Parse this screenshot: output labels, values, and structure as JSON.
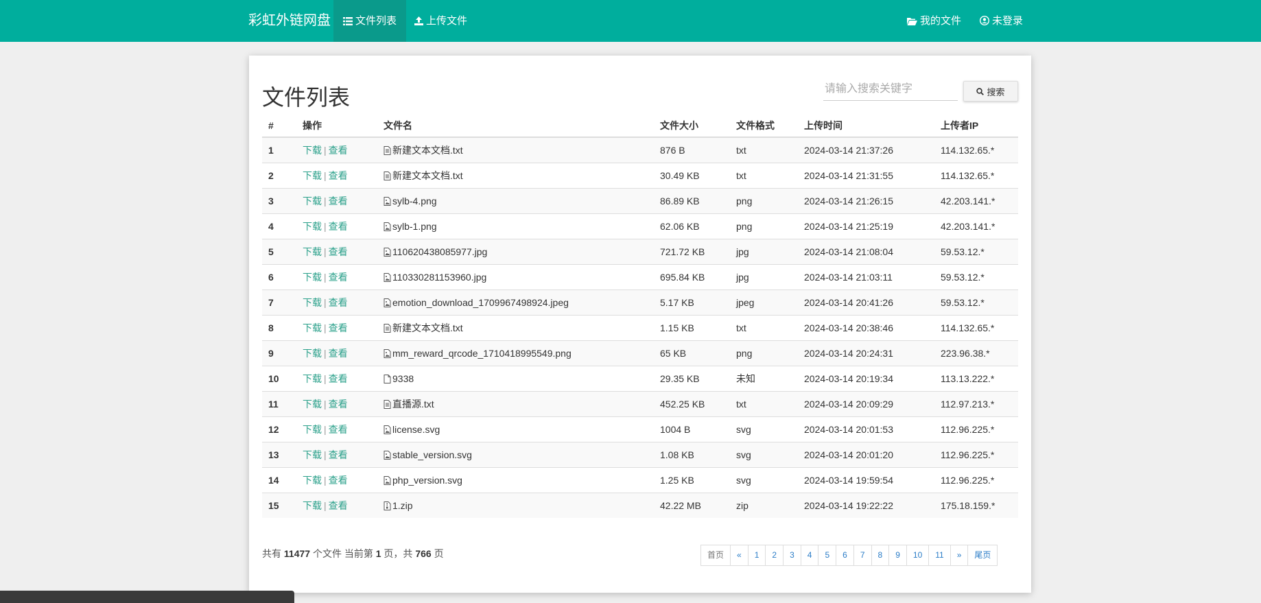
{
  "nav": {
    "brand": "彩虹外链网盘",
    "items": [
      {
        "label": "文件列表",
        "icon": "list-icon"
      },
      {
        "label": "上传文件",
        "icon": "upload-icon"
      }
    ],
    "right_items": [
      {
        "label": "我的文件",
        "icon": "folder-open-icon"
      },
      {
        "label": "未登录",
        "icon": "user-circle-icon"
      }
    ]
  },
  "panel": {
    "title": "文件列表",
    "search": {
      "placeholder": "请输入搜索关键字",
      "button": "搜索"
    }
  },
  "table": {
    "headers": [
      "#",
      "操作",
      "文件名",
      "文件大小",
      "文件格式",
      "上传时间",
      "上传者IP"
    ],
    "action_download": "下载",
    "action_view": "查看",
    "rows": [
      {
        "n": "1",
        "name": "新建文本文档.txt",
        "icon": "text-file-icon",
        "size": "876 B",
        "fmt": "txt",
        "time": "2024-03-14 21:37:26",
        "ip": "114.132.65.*"
      },
      {
        "n": "2",
        "name": "新建文本文档.txt",
        "icon": "text-file-icon",
        "size": "30.49 KB",
        "fmt": "txt",
        "time": "2024-03-14 21:31:55",
        "ip": "114.132.65.*"
      },
      {
        "n": "3",
        "name": "sylb-4.png",
        "icon": "image-file-icon",
        "size": "86.89 KB",
        "fmt": "png",
        "time": "2024-03-14 21:26:15",
        "ip": "42.203.141.*"
      },
      {
        "n": "4",
        "name": "sylb-1.png",
        "icon": "image-file-icon",
        "size": "62.06 KB",
        "fmt": "png",
        "time": "2024-03-14 21:25:19",
        "ip": "42.203.141.*"
      },
      {
        "n": "5",
        "name": "110620438085977.jpg",
        "icon": "image-file-icon",
        "size": "721.72 KB",
        "fmt": "jpg",
        "time": "2024-03-14 21:08:04",
        "ip": "59.53.12.*"
      },
      {
        "n": "6",
        "name": "110330281153960.jpg",
        "icon": "image-file-icon",
        "size": "695.84 KB",
        "fmt": "jpg",
        "time": "2024-03-14 21:03:11",
        "ip": "59.53.12.*"
      },
      {
        "n": "7",
        "name": "emotion_download_1709967498924.jpeg",
        "icon": "image-file-icon",
        "size": "5.17 KB",
        "fmt": "jpeg",
        "time": "2024-03-14 20:41:26",
        "ip": "59.53.12.*"
      },
      {
        "n": "8",
        "name": "新建文本文档.txt",
        "icon": "text-file-icon",
        "size": "1.15 KB",
        "fmt": "txt",
        "time": "2024-03-14 20:38:46",
        "ip": "114.132.65.*"
      },
      {
        "n": "9",
        "name": "mm_reward_qrcode_1710418995549.png",
        "icon": "image-file-icon",
        "size": "65 KB",
        "fmt": "png",
        "time": "2024-03-14 20:24:31",
        "ip": "223.96.38.*"
      },
      {
        "n": "10",
        "name": "9338",
        "icon": "blank-file-icon",
        "size": "29.35 KB",
        "fmt": "未知",
        "time": "2024-03-14 20:19:34",
        "ip": "113.13.222.*"
      },
      {
        "n": "11",
        "name": "直播源.txt",
        "icon": "text-file-icon",
        "size": "452.25 KB",
        "fmt": "txt",
        "time": "2024-03-14 20:09:29",
        "ip": "112.97.213.*"
      },
      {
        "n": "12",
        "name": "license.svg",
        "icon": "image-file-icon",
        "size": "1004 B",
        "fmt": "svg",
        "time": "2024-03-14 20:01:53",
        "ip": "112.96.225.*"
      },
      {
        "n": "13",
        "name": "stable_version.svg",
        "icon": "image-file-icon",
        "size": "1.08 KB",
        "fmt": "svg",
        "time": "2024-03-14 20:01:20",
        "ip": "112.96.225.*"
      },
      {
        "n": "14",
        "name": "php_version.svg",
        "icon": "image-file-icon",
        "size": "1.25 KB",
        "fmt": "svg",
        "time": "2024-03-14 19:59:54",
        "ip": "112.96.225.*"
      },
      {
        "n": "15",
        "name": "1.zip",
        "icon": "archive-file-icon",
        "size": "42.22 MB",
        "fmt": "zip",
        "time": "2024-03-14 19:22:22",
        "ip": "175.18.159.*"
      }
    ]
  },
  "summary": {
    "prefix": "共有",
    "total": "11477",
    "mid1": "个文件 当前第",
    "page": "1",
    "mid2": "页，共",
    "pages": "766",
    "suffix": "页"
  },
  "pagination": [
    "首页",
    "«",
    "1",
    "2",
    "3",
    "4",
    "5",
    "6",
    "7",
    "8",
    "9",
    "10",
    "11",
    "»",
    "尾页"
  ],
  "colors": {
    "navbar": "#00ae9d",
    "action_link": "#2aa08a",
    "format_link": "#1a34d8"
  }
}
